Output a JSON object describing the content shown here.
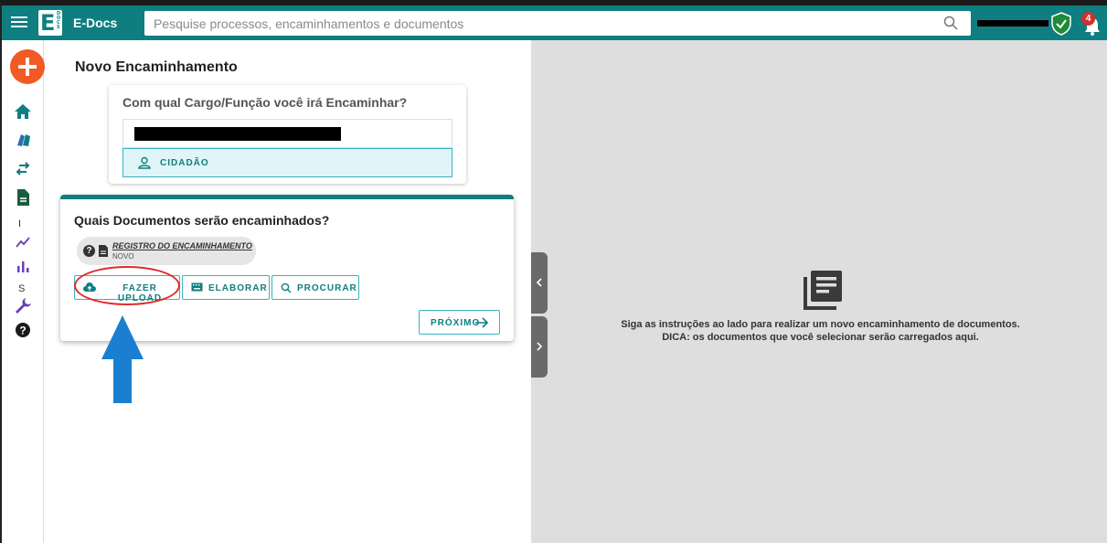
{
  "app": {
    "name": "E-Docs",
    "logo_letter": "E",
    "logo_small": "DOCS"
  },
  "search": {
    "placeholder": "Pesquise processos, encaminhamentos e documentos",
    "value": ""
  },
  "notifications": {
    "count": "4"
  },
  "sidebar": {
    "items": [
      {
        "icon": "home-icon"
      },
      {
        "icon": "boxes-icon"
      },
      {
        "icon": "swap-arrows-icon"
      },
      {
        "icon": "document-icon"
      },
      {
        "letter": "I"
      },
      {
        "icon": "trend-line-icon"
      },
      {
        "icon": "bar-chart-icon"
      },
      {
        "letter": "S"
      },
      {
        "icon": "wrench-icon"
      },
      {
        "icon": "help-icon"
      }
    ]
  },
  "main": {
    "title": "Novo Encaminhamento",
    "role_card": {
      "question": "Com qual Cargo/Função você irá Encaminhar?",
      "option": "CIDADÃO"
    },
    "docs_card": {
      "question": "Quais Documentos serão encaminhados?",
      "chip_name": "REGISTRO DO ENCAMINHAMENTO",
      "chip_status": "NOVO",
      "upload_label": "FAZER UPLOAD",
      "elaborate_label": "ELABORAR",
      "search_label": "PROCURAR",
      "next_label": "PRÓXIMO"
    }
  },
  "right_panel": {
    "line1": "Siga as instruções ao lado para realizar um novo encaminhamento de documentos.",
    "line2": "DICA: os documentos que você selecionar serão carregados aqui."
  },
  "colors": {
    "primary": "#0f7e80",
    "accent": "#37b3bf",
    "fab": "#f15a24",
    "annotation": "#e02b2b",
    "arrow": "#1a7fd0"
  }
}
